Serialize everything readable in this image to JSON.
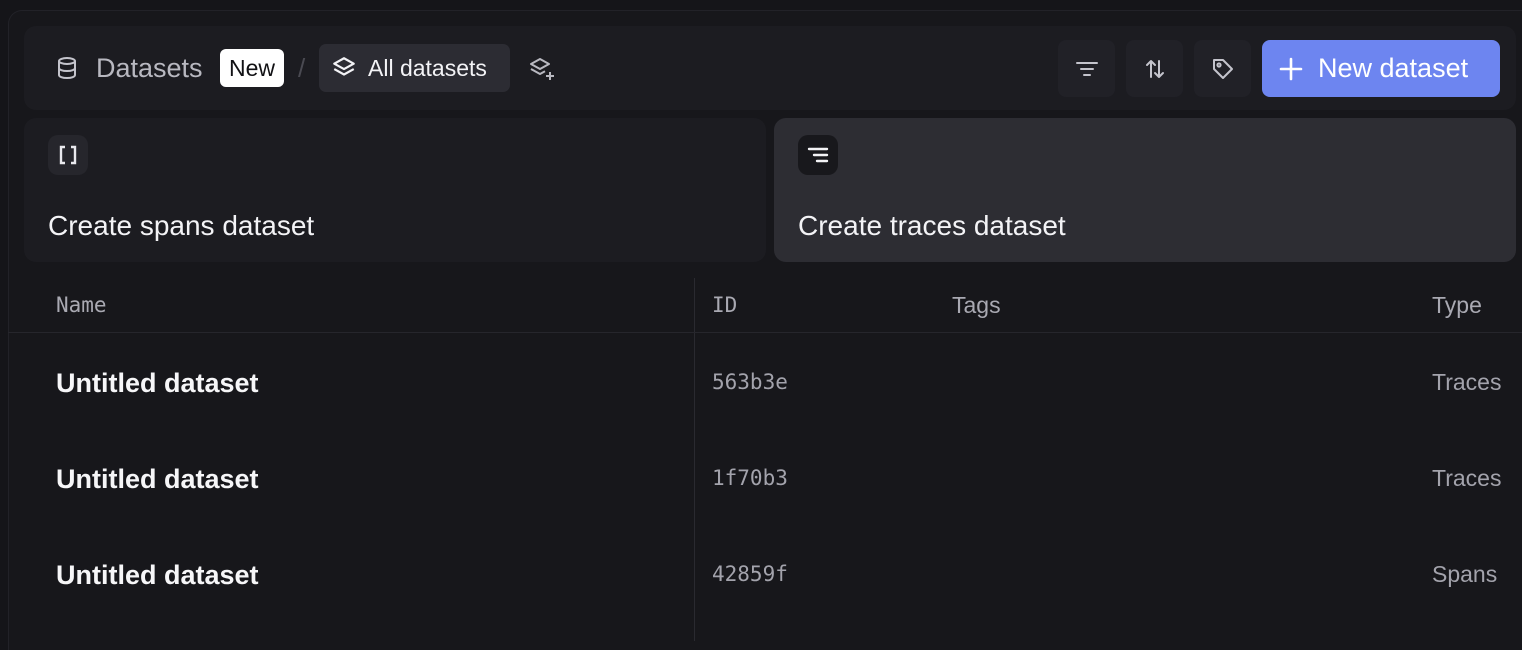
{
  "header": {
    "title": "Datasets",
    "badge": "New",
    "separator": "/",
    "view_selector_label": "All datasets",
    "new_button_label": "New dataset"
  },
  "icons": {
    "title_icon": "database-icon",
    "view_icon": "layers-icon",
    "add_view_icon": "layers-plus-icon",
    "filter": "filter-icon",
    "sort": "sort-arrows-icon",
    "tags": "tag-icon",
    "new": "plus-icon"
  },
  "cards": [
    {
      "label": "Create spans dataset",
      "icon": "brackets-icon"
    },
    {
      "label": "Create traces dataset",
      "icon": "lines-icon"
    }
  ],
  "table": {
    "columns": [
      "Name",
      "ID",
      "Tags",
      "Type"
    ],
    "rows": [
      {
        "name": "Untitled dataset",
        "id": "563b3e",
        "tags": "",
        "type": "Traces"
      },
      {
        "name": "Untitled dataset",
        "id": "1f70b3",
        "tags": "",
        "type": "Traces"
      },
      {
        "name": "Untitled dataset",
        "id": "42859f",
        "tags": "",
        "type": "Spans"
      }
    ]
  },
  "colors": {
    "background": "#151519",
    "surface": "#1c1c21",
    "surface_active": "#2d2d33",
    "accent": "#6d85f0",
    "text_primary": "#f3f3f6",
    "text_muted": "#a3a3ac"
  }
}
